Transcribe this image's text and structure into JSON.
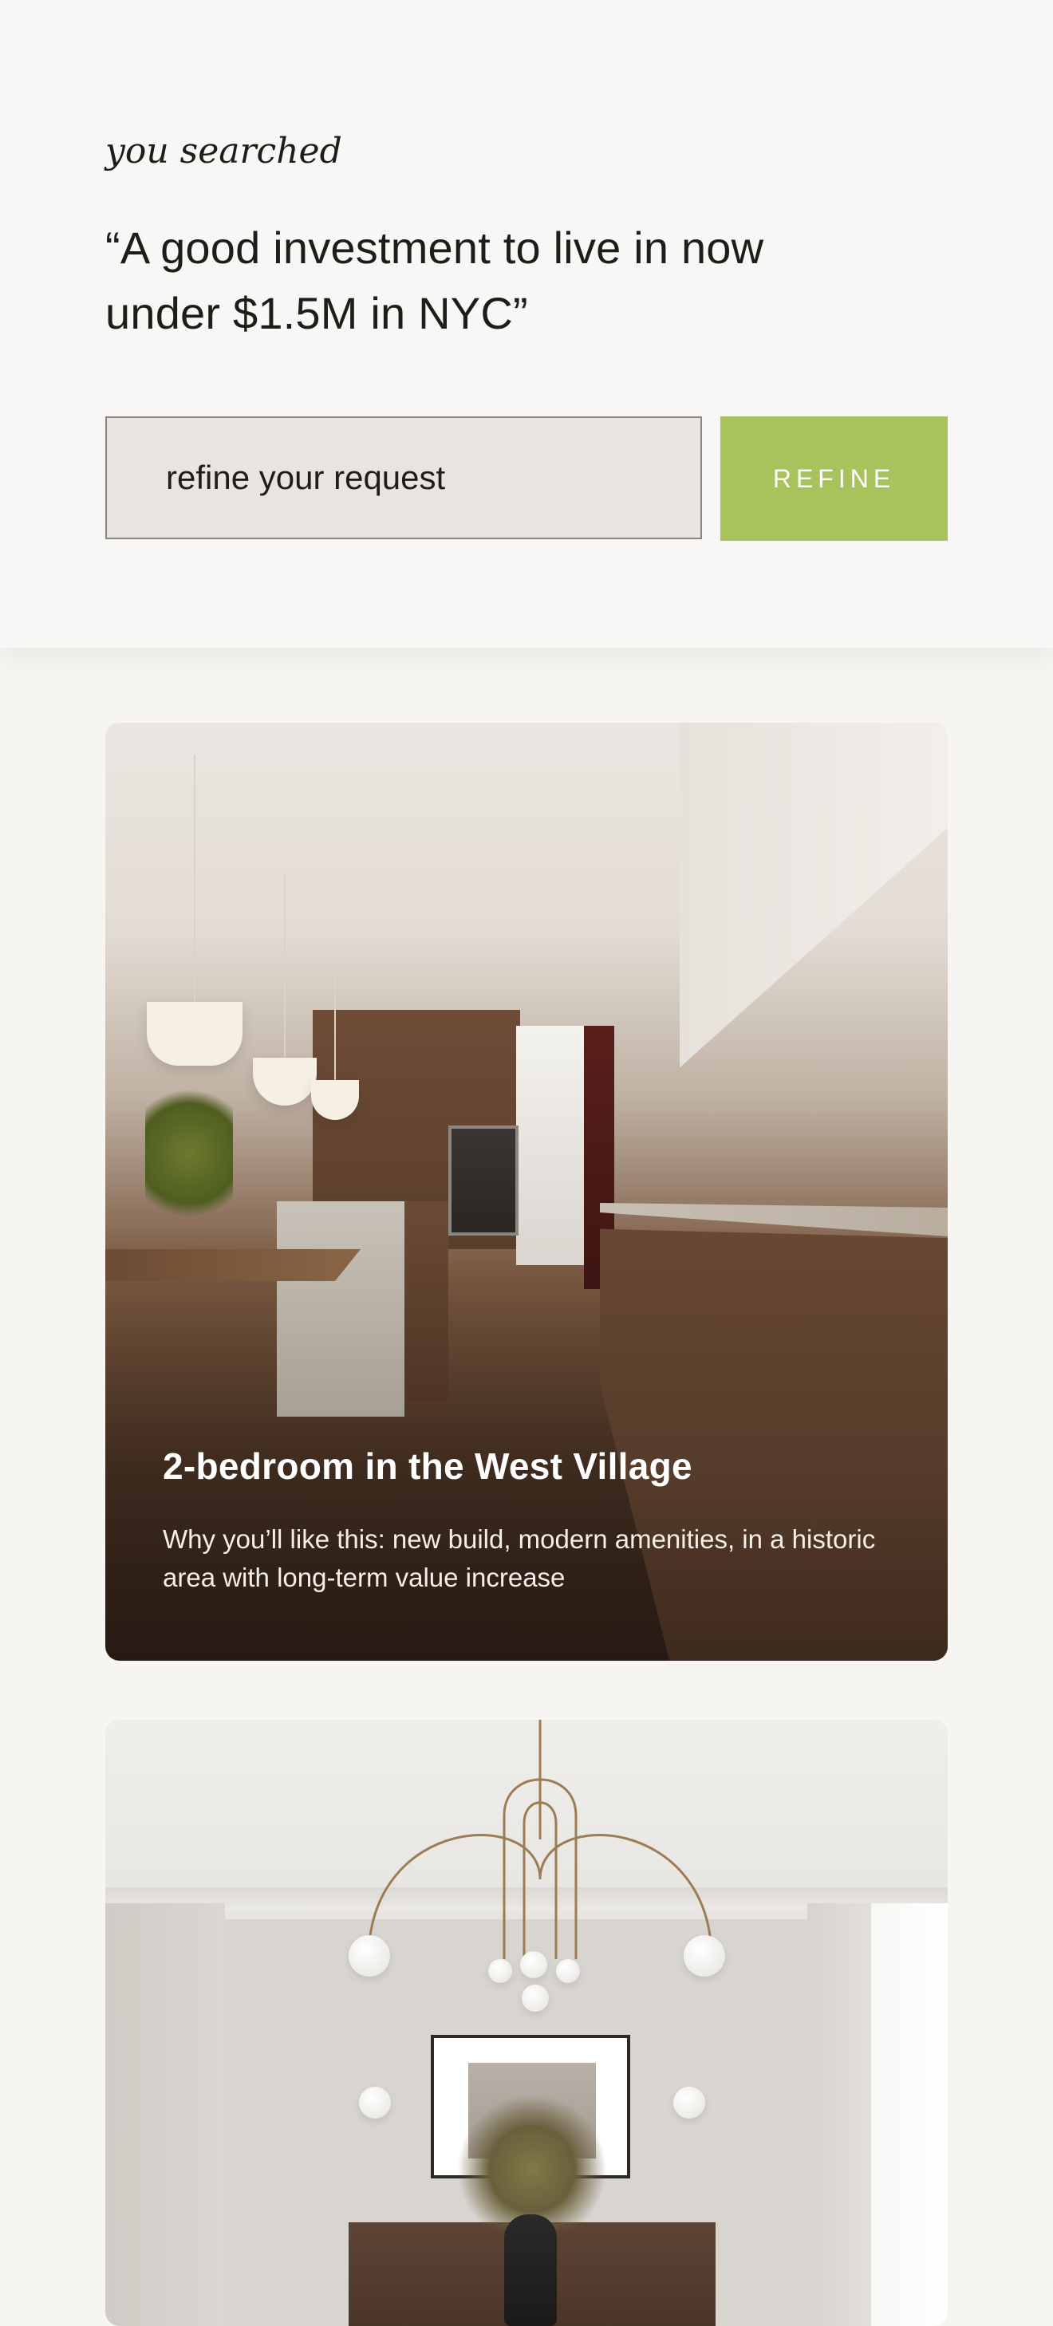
{
  "search": {
    "label": "you searched",
    "query": "“A good investment to live in now under $1.5M in NYC”",
    "refine_placeholder": "refine your request",
    "refine_button_label": "REFINE"
  },
  "colors": {
    "accent": "#a8c35c",
    "panel_bg": "#f9f7f5",
    "input_bg": "#e8e5e0",
    "text": "#1f1d1a"
  },
  "listings": [
    {
      "title": "2-bedroom in the West Village",
      "description": "Why you’ll like this: new build, modern amenities, in a historic area with long-term value increase",
      "image": "kitchen-interior-image"
    },
    {
      "title": "",
      "description": "",
      "image": "dining-room-interior-image"
    }
  ]
}
